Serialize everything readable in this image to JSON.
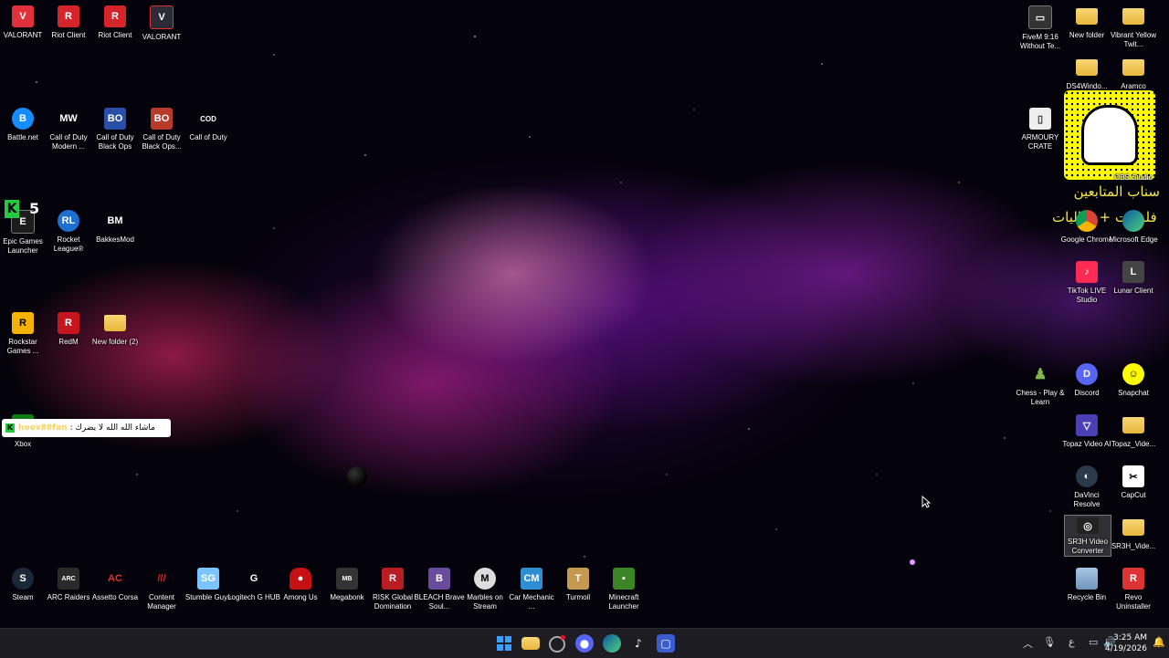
{
  "desktop_icons": {
    "valorant1": "VALORANT",
    "riot1": "Riot Client",
    "riot2": "Riot Client",
    "valorant2": "VALORANT",
    "battlenet": "Battle.net",
    "cod_modern": "Call of Duty Modern ...",
    "cod_bo": "Call of Duty Black Ops",
    "cod_bo2": "Call of Duty Black Ops...",
    "cod": "Call of Duty",
    "epic": "Epic Games Launcher",
    "rocket": "Rocket League®",
    "bakkes": "BakkesMod",
    "rockstar": "Rockstar Games ...",
    "redm": "RedM",
    "newfolder2": "New folder (2)",
    "xbox": "Xbox",
    "steam": "Steam",
    "arc": "ARC Raiders",
    "assetto": "Assetto Corsa",
    "content": "Content Manager",
    "stumble": "Stumble Guys",
    "logitech": "Logitech G HUB",
    "amongus": "Among Us",
    "megabonk": "Megabonk",
    "risk": "RISK Global Domination",
    "bleach": "BLEACH Brave Soul...",
    "marbles": "Marbles on Stream",
    "carmech": "Car Mechanic ...",
    "turmoil": "Turmoil",
    "minecraft": "Minecraft Launcher",
    "fivem": "FiveM 9:16 Without Te...",
    "newfolder": "New folder",
    "vibrant": "Vibrant Yellow Twit...",
    "ds4": "DS4Windo...",
    "aramco": "Aramco",
    "armoury": "ARMOURY CRATE",
    "obs": "OBS Studio",
    "chrome": "Google Chrome",
    "edge": "Microsoft Edge",
    "tiktok_live": "TikTok LIVE Studio",
    "lunar": "Lunar Client",
    "chess": "Chess - Play & Learn",
    "discord": "Discord",
    "snapchat": "Snapchat",
    "topaz": "Topaz Video AI",
    "topaz_folder": "Topaz_Vide...",
    "davinci": "DaVinci Resolve",
    "capcut": "CapCut",
    "sr3h": "SR3H Video Converter",
    "sr3h_folder": "SR3H_Vide...",
    "recycle": "Recycle Bin",
    "revo": "Revo Uninstaller"
  },
  "overlay": {
    "snap_line1": "سناب المتابعين",
    "snap_line2": "فلوقات + فعاليات",
    "chat_badge": "K",
    "chat_user": "hoov88fan",
    "chat_message": ": ماشاء الله الله لا يضرك",
    "epic_badge": "5"
  },
  "taskbar": {
    "tray_lang": "ع",
    "time": "3:25 AM",
    "date": "4/19/2026"
  },
  "colors": {
    "valorant": "#e0303a",
    "riot": "#d6242b",
    "snap_yellow": "#fffc00",
    "chat_user": "#f7d35e",
    "taskbar": "#1c1c22"
  }
}
